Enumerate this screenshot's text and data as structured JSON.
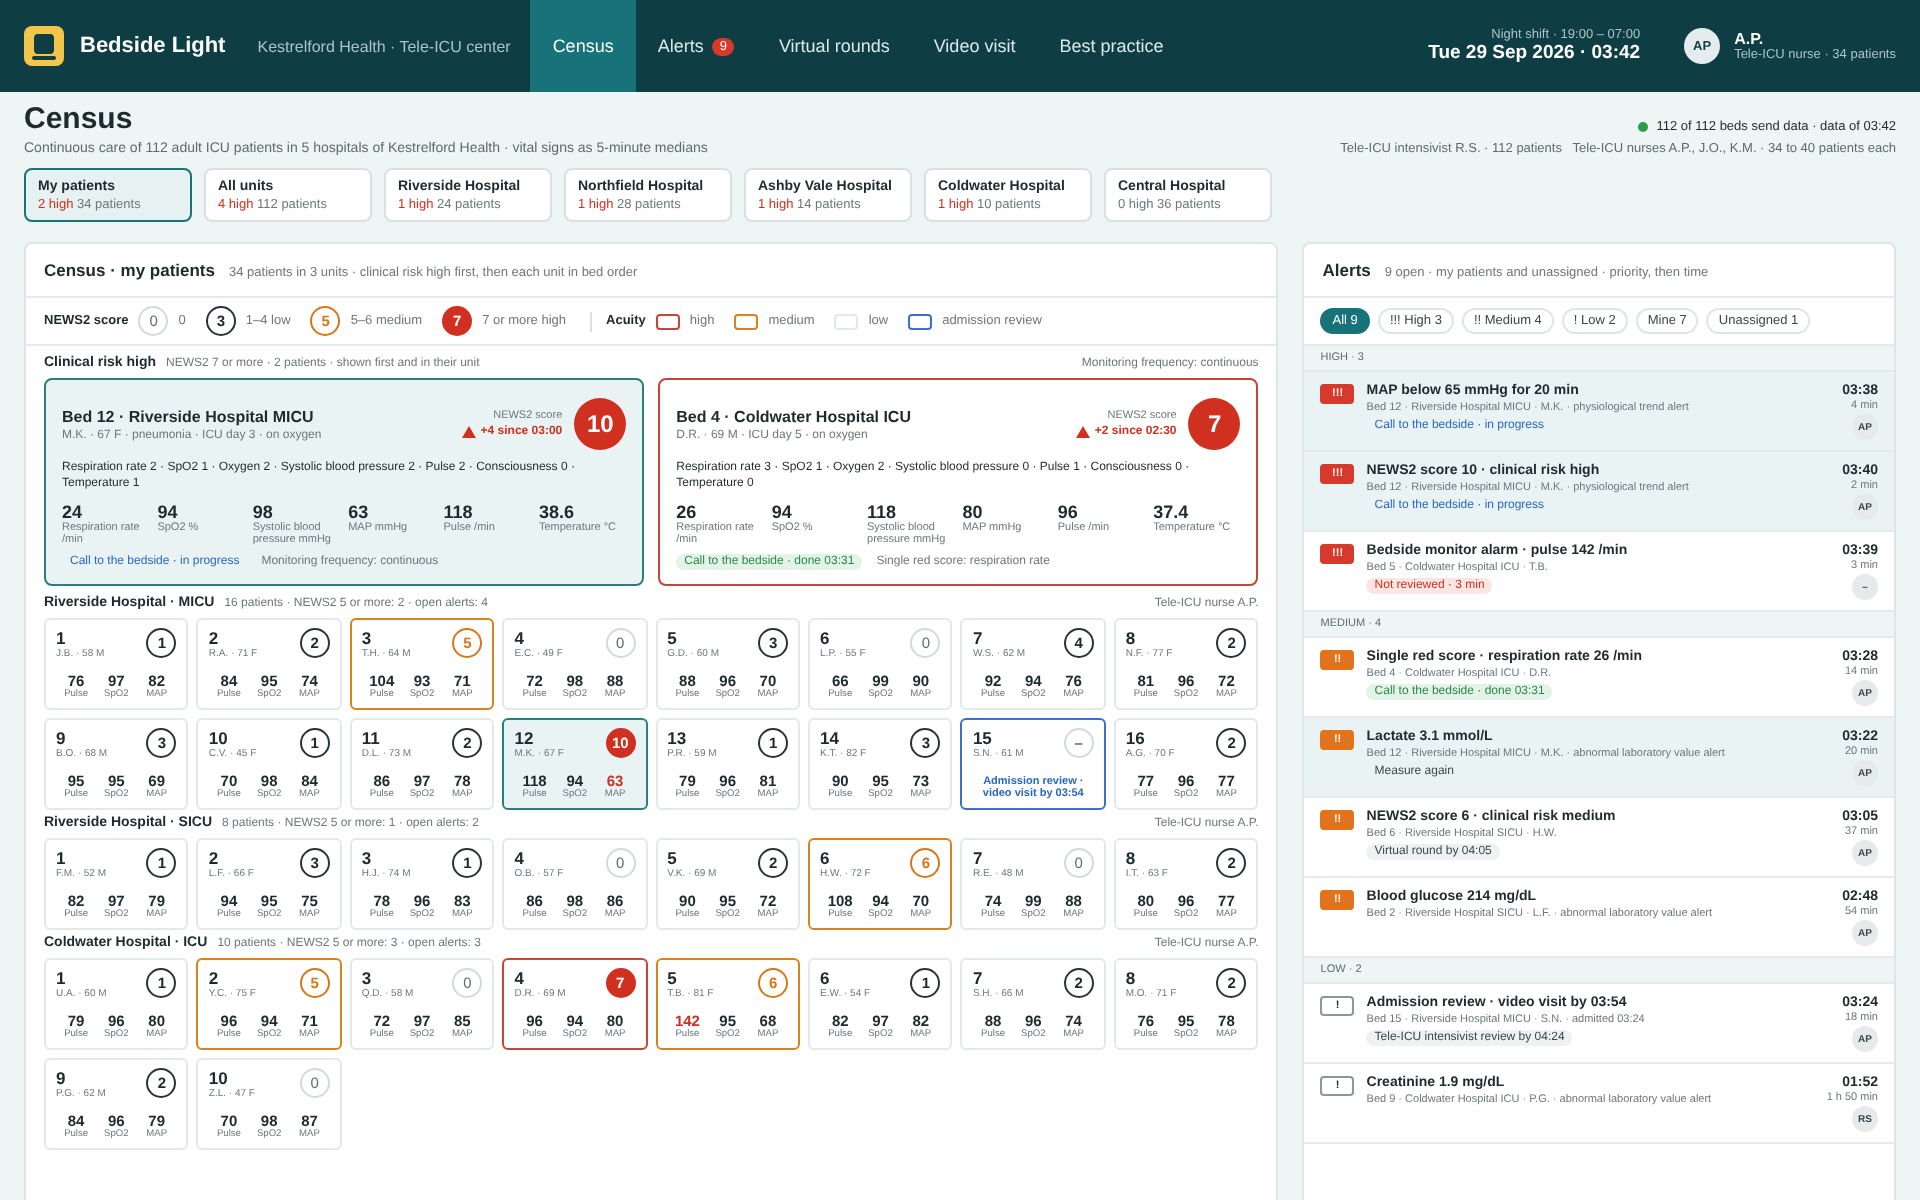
{
  "topbar": {
    "app_name": "Bedside Light",
    "org": "Kestrelford Health · Tele-ICU center",
    "shift": "Night shift · 19:00 – 07:00",
    "date": "Tue 29 Sep 2026 · 03:42",
    "avatar": "AP",
    "user": "A.P.",
    "role": "Tele-ICU nurse · 34 patients"
  },
  "nav": [
    {
      "label": "Census",
      "selected": true
    },
    {
      "label": "Alerts",
      "selected": false,
      "badge": "9"
    },
    {
      "label": "Virtual rounds",
      "selected": false
    },
    {
      "label": "Video visit",
      "selected": false
    },
    {
      "label": "Best practice",
      "selected": false
    }
  ],
  "header": {
    "title": "Census",
    "subtitle": "Continuous care of 112 adult ICU patients in 5 hospitals of Kestrelford Health · vital signs as 5-minute medians",
    "data_status": "112 of 112 beds send data · data of 03:42",
    "staff": "Tele-ICU intensivist R.S. · 112 patients   Tele-ICU nurses A.P., J.O., K.M. · 34 to 40 patients each"
  },
  "hospitals": [
    {
      "name": "My patients",
      "high": "2 high",
      "alert": true,
      "count": "34 patients",
      "selected": true
    },
    {
      "name": "All units",
      "high": "4 high",
      "alert": true,
      "count": "112 patients",
      "selected": false
    },
    {
      "name": "Riverside Hospital",
      "high": "1 high",
      "alert": true,
      "count": "24 patients",
      "selected": false
    },
    {
      "name": "Northfield Hospital",
      "high": "1 high",
      "alert": true,
      "count": "28 patients",
      "selected": false
    },
    {
      "name": "Ashby Vale Hospital",
      "high": "1 high",
      "alert": true,
      "count": "14 patients",
      "selected": false
    },
    {
      "name": "Coldwater Hospital",
      "high": "1 high",
      "alert": true,
      "count": "10 patients",
      "selected": false
    },
    {
      "name": "Central Hospital",
      "high": "0 high",
      "alert": false,
      "count": "36 patients",
      "selected": false
    }
  ],
  "census": {
    "title": "Census · my patients",
    "summary": "34 patients in 3 units · clinical risk high first, then each unit in bed order",
    "legend": {
      "score_title": "NEWS2 score",
      "scores": [
        {
          "score": {
            "value": "0",
            "kind": "zero"
          },
          "label": "0"
        },
        {
          "score": {
            "value": "3",
            "kind": "low"
          },
          "label": "1–4 low"
        },
        {
          "score": {
            "value": "5",
            "kind": "medium"
          },
          "label": "5–6 medium"
        },
        {
          "score": {
            "value": "7",
            "kind": "high"
          },
          "label": "7 or more high"
        }
      ],
      "acuity_title": "Acuity",
      "acuity": [
        {
          "label": "high",
          "kind": "high"
        },
        {
          "label": "medium",
          "kind": "medium"
        },
        {
          "label": "low",
          "kind": "low"
        },
        {
          "label": "admission review",
          "kind": "review"
        }
      ]
    },
    "risk": {
      "title": "Clinical risk high",
      "summary": "NEWS2 7 or more · 2 patients · shown first and in their unit",
      "frequency": "Monitoring frequency: continuous",
      "cards": [
        {
          "title": "Bed 12 · Riverside Hospital MICU",
          "patient": "M.K. · 67 F · pneumonia · ICU day 3 · on oxygen",
          "score_label": "NEWS2 score",
          "trend": "+4 since 03:00",
          "score": {
            "value": "10",
            "kind": "high"
          },
          "kind": "high",
          "selected": true,
          "breakdown": "Respiration rate 2 · SpO2 1 · Oxygen 2 · Systolic blood pressure 2 · Pulse 2 · Consciousness 0 · Temperature 1",
          "vitals": [
            {
              "value": "24",
              "label": "Respiration rate /min"
            },
            {
              "value": "94",
              "label": "SpO2 %"
            },
            {
              "value": "98",
              "label": "Systolic blood pressure mmHg"
            },
            {
              "value": "63",
              "label": "MAP mmHg"
            },
            {
              "value": "118",
              "label": "Pulse /min"
            },
            {
              "value": "38.6",
              "label": "Temperature °C"
            }
          ],
          "status": {
            "text": "Call to the bedside · in progress",
            "kind": "progress"
          },
          "note": "Monitoring frequency: continuous"
        },
        {
          "title": "Bed 4 · Coldwater Hospital ICU",
          "patient": "D.R. · 69 M · ICU day 5 · on oxygen",
          "score_label": "NEWS2 score",
          "trend": "+2 since 02:30",
          "score": {
            "value": "7",
            "kind": "high"
          },
          "kind": "high",
          "selected": false,
          "breakdown": "Respiration rate 3 · SpO2 1 · Oxygen 2 · Systolic blood pressure 0 · Pulse 1 · Consciousness 0 · Temperature 0",
          "vitals": [
            {
              "value": "26",
              "label": "Respiration rate /min"
            },
            {
              "value": "94",
              "label": "SpO2 %"
            },
            {
              "value": "118",
              "label": "Systolic blood pressure mmHg"
            },
            {
              "value": "80",
              "label": "MAP mmHg"
            },
            {
              "value": "96",
              "label": "Pulse /min"
            },
            {
              "value": "37.4",
              "label": "Temperature °C"
            }
          ],
          "status": {
            "text": "Call to the bedside · done 03:31",
            "kind": "done"
          },
          "note": "Single red score: respiration rate"
        }
      ]
    },
    "units": [
      {
        "name": "Riverside Hospital · MICU",
        "summary": "16 patients · NEWS2 5 or more: 2 · open alerts: 4",
        "nurse": "Tele-ICU nurse A.P.",
        "tiles": [
          {
            "bed": "1",
            "patient": "J.B. · 58 M",
            "score": {
              "value": "1",
              "kind": "low"
            },
            "kind": "low",
            "selected": false,
            "vitals": [
              {
                "value": "76",
                "label": "Pulse",
                "abnormal": false
              },
              {
                "value": "97",
                "label": "SpO2",
                "abnormal": false
              },
              {
                "value": "82",
                "label": "MAP",
                "abnormal": false
              }
            ]
          },
          {
            "bed": "2",
            "patient": "R.A. · 71 F",
            "score": {
              "value": "2",
              "kind": "low"
            },
            "kind": "low",
            "selected": false,
            "vitals": [
              {
                "value": "84",
                "label": "Pulse",
                "abnormal": false
              },
              {
                "value": "95",
                "label": "SpO2",
                "abnormal": false
              },
              {
                "value": "74",
                "label": "MAP",
                "abnormal": false
              }
            ]
          },
          {
            "bed": "3",
            "patient": "T.H. · 64 M",
            "score": {
              "value": "5",
              "kind": "medium"
            },
            "kind": "medium",
            "selected": false,
            "vitals": [
              {
                "value": "104",
                "label": "Pulse",
                "abnormal": false
              },
              {
                "value": "93",
                "label": "SpO2",
                "abnormal": false
              },
              {
                "value": "71",
                "label": "MAP",
                "abnormal": false
              }
            ]
          },
          {
            "bed": "4",
            "patient": "E.C. · 49 F",
            "score": {
              "value": "0",
              "kind": "zero"
            },
            "kind": "low",
            "selected": false,
            "vitals": [
              {
                "value": "72",
                "label": "Pulse",
                "abnormal": false
              },
              {
                "value": "98",
                "label": "SpO2",
                "abnormal": false
              },
              {
                "value": "88",
                "label": "MAP",
                "abnormal": false
              }
            ]
          },
          {
            "bed": "5",
            "patient": "G.D. · 60 M",
            "score": {
              "value": "3",
              "kind": "low"
            },
            "kind": "low",
            "selected": false,
            "vitals": [
              {
                "value": "88",
                "label": "Pulse",
                "abnormal": false
              },
              {
                "value": "96",
                "label": "SpO2",
                "abnormal": false
              },
              {
                "value": "70",
                "label": "MAP",
                "abnormal": false
              }
            ]
          },
          {
            "bed": "6",
            "patient": "L.P. · 55 F",
            "score": {
              "value": "0",
              "kind": "zero"
            },
            "kind": "low",
            "selected": false,
            "vitals": [
              {
                "value": "66",
                "label": "Pulse",
                "abnormal": false
              },
              {
                "value": "99",
                "label": "SpO2",
                "abnormal": false
              },
              {
                "value": "90",
                "label": "MAP",
                "abnormal": false
              }
            ]
          },
          {
            "bed": "7",
            "patient": "W.S. · 62 M",
            "score": {
              "value": "4",
              "kind": "low"
            },
            "kind": "low",
            "selected": false,
            "vitals": [
              {
                "value": "92",
                "label": "Pulse",
                "abnormal": false
              },
              {
                "value": "94",
                "label": "SpO2",
                "abnormal": false
              },
              {
                "value": "76",
                "label": "MAP",
                "abnormal": false
              }
            ]
          },
          {
            "bed": "8",
            "patient": "N.F. · 77 F",
            "score": {
              "value": "2",
              "kind": "low"
            },
            "kind": "low",
            "selected": false,
            "vitals": [
              {
                "value": "81",
                "label": "Pulse",
                "abnormal": false
              },
              {
                "value": "96",
                "label": "SpO2",
                "abnormal": false
              },
              {
                "value": "72",
                "label": "MAP",
                "abnormal": false
              }
            ]
          },
          {
            "bed": "9",
            "patient": "B.O. · 68 M",
            "score": {
              "value": "3",
              "kind": "low"
            },
            "kind": "low",
            "selected": false,
            "vitals": [
              {
                "value": "95",
                "label": "Pulse",
                "abnormal": false
              },
              {
                "value": "95",
                "label": "SpO2",
                "abnormal": false
              },
              {
                "value": "69",
                "label": "MAP",
                "abnormal": false
              }
            ]
          },
          {
            "bed": "10",
            "patient": "C.V. · 45 F",
            "score": {
              "value": "1",
              "kind": "low"
            },
            "kind": "low",
            "selected": false,
            "vitals": [
              {
                "value": "70",
                "label": "Pulse",
                "abnormal": false
              },
              {
                "value": "98",
                "label": "SpO2",
                "abnormal": false
              },
              {
                "value": "84",
                "label": "MAP",
                "abnormal": false
              }
            ]
          },
          {
            "bed": "11",
            "patient": "D.L. · 73 M",
            "score": {
              "value": "2",
              "kind": "low"
            },
            "kind": "low",
            "selected": false,
            "vitals": [
              {
                "value": "86",
                "label": "Pulse",
                "abnormal": false
              },
              {
                "value": "97",
                "label": "SpO2",
                "abnormal": false
              },
              {
                "value": "78",
                "label": "MAP",
                "abnormal": false
              }
            ]
          },
          {
            "bed": "12",
            "patient": "M.K. · 67 F",
            "score": {
              "value": "10",
              "kind": "high"
            },
            "kind": "high",
            "selected": true,
            "vitals": [
              {
                "value": "118",
                "label": "Pulse",
                "abnormal": false
              },
              {
                "value": "94",
                "label": "SpO2",
                "abnormal": false
              },
              {
                "value": "63",
                "label": "MAP",
                "abnormal": true
              }
            ]
          },
          {
            "bed": "13",
            "patient": "P.R. · 59 M",
            "score": {
              "value": "1",
              "kind": "low"
            },
            "kind": "low",
            "selected": false,
            "vitals": [
              {
                "value": "79",
                "label": "Pulse",
                "abnormal": false
              },
              {
                "value": "96",
                "label": "SpO2",
                "abnormal": false
              },
              {
                "value": "81",
                "label": "MAP",
                "abnormal": false
              }
            ]
          },
          {
            "bed": "14",
            "patient": "K.T. · 82 F",
            "score": {
              "value": "3",
              "kind": "low"
            },
            "kind": "low",
            "selected": false,
            "vitals": [
              {
                "value": "90",
                "label": "Pulse",
                "abnormal": false
              },
              {
                "value": "95",
                "label": "SpO2",
                "abnormal": false
              },
              {
                "value": "73",
                "label": "MAP",
                "abnormal": false
              }
            ]
          },
          {
            "bed": "15",
            "patient": "S.N. · 61 M",
            "score": {
              "value": "–",
              "kind": "none"
            },
            "kind": "review",
            "selected": false,
            "note": "Admission review · video visit by 03:54"
          },
          {
            "bed": "16",
            "patient": "A.G. · 70 F",
            "score": {
              "value": "2",
              "kind": "low"
            },
            "kind": "low",
            "selected": false,
            "vitals": [
              {
                "value": "77",
                "label": "Pulse",
                "abnormal": false
              },
              {
                "value": "96",
                "label": "SpO2",
                "abnormal": false
              },
              {
                "value": "77",
                "label": "MAP",
                "abnormal": false
              }
            ]
          }
        ]
      },
      {
        "name": "Riverside Hospital · SICU",
        "summary": "8 patients · NEWS2 5 or more: 1 · open alerts: 2",
        "nurse": "Tele-ICU nurse A.P.",
        "tiles": [
          {
            "bed": "1",
            "patient": "F.M. · 52 M",
            "score": {
              "value": "1",
              "kind": "low"
            },
            "kind": "low",
            "selected": false,
            "vitals": [
              {
                "value": "82",
                "label": "Pulse",
                "abnormal": false
              },
              {
                "value": "97",
                "label": "SpO2",
                "abnormal": false
              },
              {
                "value": "79",
                "label": "MAP",
                "abnormal": false
              }
            ]
          },
          {
            "bed": "2",
            "patient": "L.F. · 66 F",
            "score": {
              "value": "3",
              "kind": "low"
            },
            "kind": "low",
            "selected": false,
            "vitals": [
              {
                "value": "94",
                "label": "Pulse",
                "abnormal": false
              },
              {
                "value": "95",
                "label": "SpO2",
                "abnormal": false
              },
              {
                "value": "75",
                "label": "MAP",
                "abnormal": false
              }
            ]
          },
          {
            "bed": "3",
            "patient": "H.J. · 74 M",
            "score": {
              "value": "1",
              "kind": "low"
            },
            "kind": "low",
            "selected": false,
            "vitals": [
              {
                "value": "78",
                "label": "Pulse",
                "abnormal": false
              },
              {
                "value": "96",
                "label": "SpO2",
                "abnormal": false
              },
              {
                "value": "83",
                "label": "MAP",
                "abnormal": false
              }
            ]
          },
          {
            "bed": "4",
            "patient": "O.B. · 57 F",
            "score": {
              "value": "0",
              "kind": "zero"
            },
            "kind": "low",
            "selected": false,
            "vitals": [
              {
                "value": "86",
                "label": "Pulse",
                "abnormal": false
              },
              {
                "value": "98",
                "label": "SpO2",
                "abnormal": false
              },
              {
                "value": "86",
                "label": "MAP",
                "abnormal": false
              }
            ]
          },
          {
            "bed": "5",
            "patient": "V.K. · 69 M",
            "score": {
              "value": "2",
              "kind": "low"
            },
            "kind": "low",
            "selected": false,
            "vitals": [
              {
                "value": "90",
                "label": "Pulse",
                "abnormal": false
              },
              {
                "value": "95",
                "label": "SpO2",
                "abnormal": false
              },
              {
                "value": "72",
                "label": "MAP",
                "abnormal": false
              }
            ]
          },
          {
            "bed": "6",
            "patient": "H.W. · 72 F",
            "score": {
              "value": "6",
              "kind": "medium"
            },
            "kind": "medium",
            "selected": false,
            "vitals": [
              {
                "value": "108",
                "label": "Pulse",
                "abnormal": false
              },
              {
                "value": "94",
                "label": "SpO2",
                "abnormal": false
              },
              {
                "value": "70",
                "label": "MAP",
                "abnormal": false
              }
            ]
          },
          {
            "bed": "7",
            "patient": "R.E. · 48 M",
            "score": {
              "value": "0",
              "kind": "zero"
            },
            "kind": "low",
            "selected": false,
            "vitals": [
              {
                "value": "74",
                "label": "Pulse",
                "abnormal": false
              },
              {
                "value": "99",
                "label": "SpO2",
                "abnormal": false
              },
              {
                "value": "88",
                "label": "MAP",
                "abnormal": false
              }
            ]
          },
          {
            "bed": "8",
            "patient": "I.T. · 63 F",
            "score": {
              "value": "2",
              "kind": "low"
            },
            "kind": "low",
            "selected": false,
            "vitals": [
              {
                "value": "80",
                "label": "Pulse",
                "abnormal": false
              },
              {
                "value": "96",
                "label": "SpO2",
                "abnormal": false
              },
              {
                "value": "77",
                "label": "MAP",
                "abnormal": false
              }
            ]
          }
        ]
      },
      {
        "name": "Coldwater Hospital · ICU",
        "summary": "10 patients · NEWS2 5 or more: 3 · open alerts: 3",
        "nurse": "Tele-ICU nurse A.P.",
        "tiles": [
          {
            "bed": "1",
            "patient": "U.A. · 60 M",
            "score": {
              "value": "1",
              "kind": "low"
            },
            "kind": "low",
            "selected": false,
            "vitals": [
              {
                "value": "79",
                "label": "Pulse",
                "abnormal": false
              },
              {
                "value": "96",
                "label": "SpO2",
                "abnormal": false
              },
              {
                "value": "80",
                "label": "MAP",
                "abnormal": false
              }
            ]
          },
          {
            "bed": "2",
            "patient": "Y.C. · 75 F",
            "score": {
              "value": "5",
              "kind": "medium"
            },
            "kind": "medium",
            "selected": false,
            "vitals": [
              {
                "value": "96",
                "label": "Pulse",
                "abnormal": false
              },
              {
                "value": "94",
                "label": "SpO2",
                "abnormal": false
              },
              {
                "value": "71",
                "label": "MAP",
                "abnormal": false
              }
            ]
          },
          {
            "bed": "3",
            "patient": "Q.D. · 58 M",
            "score": {
              "value": "0",
              "kind": "zero"
            },
            "kind": "low",
            "selected": false,
            "vitals": [
              {
                "value": "72",
                "label": "Pulse",
                "abnormal": false
              },
              {
                "value": "97",
                "label": "SpO2",
                "abnormal": false
              },
              {
                "value": "85",
                "label": "MAP",
                "abnormal": false
              }
            ]
          },
          {
            "bed": "4",
            "patient": "D.R. · 69 M",
            "score": {
              "value": "7",
              "kind": "high"
            },
            "kind": "high",
            "selected": false,
            "vitals": [
              {
                "value": "96",
                "label": "Pulse",
                "abnormal": false
              },
              {
                "value": "94",
                "label": "SpO2",
                "abnormal": false
              },
              {
                "value": "80",
                "label": "MAP",
                "abnormal": false
              }
            ]
          },
          {
            "bed": "5",
            "patient": "T.B. · 81 F",
            "score": {
              "value": "6",
              "kind": "medium"
            },
            "kind": "medium",
            "selected": false,
            "vitals": [
              {
                "value": "142",
                "label": "Pulse",
                "abnormal": true
              },
              {
                "value": "95",
                "label": "SpO2",
                "abnormal": false
              },
              {
                "value": "68",
                "label": "MAP",
                "abnormal": false
              }
            ]
          },
          {
            "bed": "6",
            "patient": "E.W. · 54 F",
            "score": {
              "value": "1",
              "kind": "low"
            },
            "kind": "low",
            "selected": false,
            "vitals": [
              {
                "value": "82",
                "label": "Pulse",
                "abnormal": false
              },
              {
                "value": "97",
                "label": "SpO2",
                "abnormal": false
              },
              {
                "value": "82",
                "label": "MAP",
                "abnormal": false
              }
            ]
          },
          {
            "bed": "7",
            "patient": "S.H. · 66 M",
            "score": {
              "value": "2",
              "kind": "low"
            },
            "kind": "low",
            "selected": false,
            "vitals": [
              {
                "value": "88",
                "label": "Pulse",
                "abnormal": false
              },
              {
                "value": "96",
                "label": "SpO2",
                "abnormal": false
              },
              {
                "value": "74",
                "label": "MAP",
                "abnormal": false
              }
            ]
          },
          {
            "bed": "8",
            "patient": "M.O. · 71 F",
            "score": {
              "value": "2",
              "kind": "low"
            },
            "kind": "low",
            "selected": false,
            "vitals": [
              {
                "value": "76",
                "label": "Pulse",
                "abnormal": false
              },
              {
                "value": "95",
                "label": "SpO2",
                "abnormal": false
              },
              {
                "value": "78",
                "label": "MAP",
                "abnormal": false
              }
            ]
          },
          {
            "bed": "9",
            "patient": "P.G. · 62 M",
            "score": {
              "value": "2",
              "kind": "low"
            },
            "kind": "low",
            "selected": false,
            "vitals": [
              {
                "value": "84",
                "label": "Pulse",
                "abnormal": false
              },
              {
                "value": "96",
                "label": "SpO2",
                "abnormal": false
              },
              {
                "value": "79",
                "label": "MAP",
                "abnormal": false
              }
            ]
          },
          {
            "bed": "10",
            "patient": "Z.L. · 47 F",
            "score": {
              "value": "0",
              "kind": "zero"
            },
            "kind": "low",
            "selected": false,
            "vitals": [
              {
                "value": "70",
                "label": "Pulse",
                "abnormal": false
              },
              {
                "value": "98",
                "label": "SpO2",
                "abnormal": false
              },
              {
                "value": "87",
                "label": "MAP",
                "abnormal": false
              }
            ]
          }
        ]
      }
    ]
  },
  "alerts": {
    "title": "Alerts",
    "summary": "9 open · my patients and unassigned · priority, then time",
    "filters": [
      {
        "label": "All 9",
        "selected": true
      },
      {
        "label": "!!! High 3",
        "selected": false
      },
      {
        "label": "!! Medium 4",
        "selected": false
      },
      {
        "label": "! Low 2",
        "selected": false
      },
      {
        "label": "Mine 7",
        "selected": false
      },
      {
        "label": "Unassigned 1",
        "selected": false
      }
    ],
    "groups": [
      {
        "title": "HIGH · 3",
        "items": [
          {
            "kind": "high",
            "mark": "!!!",
            "title": "MAP below 65 mmHg for 20 min",
            "detail": "Bed 12 · Riverside Hospital MICU · M.K. · physiological trend alert",
            "status": {
              "text": "Call to the bedside · in progress",
              "kind": "progress"
            },
            "time": "03:38",
            "ago": "4 min",
            "assignee": "AP",
            "selected": true
          },
          {
            "kind": "high",
            "mark": "!!!",
            "title": "NEWS2 score 10 · clinical risk high",
            "detail": "Bed 12 · Riverside Hospital MICU · M.K. · physiological trend alert",
            "status": {
              "text": "Call to the bedside · in progress",
              "kind": "progress"
            },
            "time": "03:40",
            "ago": "2 min",
            "assignee": "AP",
            "selected": true
          },
          {
            "kind": "high",
            "mark": "!!!",
            "title": "Bedside monitor alarm · pulse 142 /min",
            "detail": "Bed 5 · Coldwater Hospital ICU · T.B.",
            "status": {
              "text": "Not reviewed · 3 min",
              "kind": "alarm"
            },
            "time": "03:39",
            "ago": "3 min",
            "assignee": "–",
            "selected": false
          }
        ]
      },
      {
        "title": "MEDIUM · 4",
        "items": [
          {
            "kind": "medium",
            "mark": "!!",
            "title": "Single red score · respiration rate 26 /min",
            "detail": "Bed 4 · Coldwater Hospital ICU · D.R.",
            "status": {
              "text": "Call to the bedside · done 03:31",
              "kind": "done"
            },
            "time": "03:28",
            "ago": "14 min",
            "assignee": "AP",
            "selected": false
          },
          {
            "kind": "medium",
            "mark": "!!",
            "title": "Lactate 3.1 mmol/L",
            "detail": "Bed 12 · Riverside Hospital MICU · M.K. · abnormal laboratory value alert",
            "status": {
              "text": "Measure again",
              "kind": "plain"
            },
            "time": "03:22",
            "ago": "20 min",
            "assignee": "AP",
            "selected": true
          },
          {
            "kind": "medium",
            "mark": "!!",
            "title": "NEWS2 score 6 · clinical risk medium",
            "detail": "Bed 6 · Riverside Hospital SICU · H.W.",
            "status": {
              "text": "Virtual round by 04:05",
              "kind": "neutral"
            },
            "time": "03:05",
            "ago": "37 min",
            "assignee": "AP",
            "selected": false
          },
          {
            "kind": "medium",
            "mark": "!!",
            "title": "Blood glucose 214 mg/dL",
            "detail": "Bed 2 · Riverside Hospital SICU · L.F. · abnormal laboratory value alert",
            "time": "02:48",
            "ago": "54 min",
            "assignee": "AP",
            "selected": false
          }
        ]
      },
      {
        "title": "LOW · 2",
        "items": [
          {
            "kind": "low",
            "mark": "!",
            "title": "Admission review · video visit by 03:54",
            "detail": "Bed 15 · Riverside Hospital MICU · S.N. · admitted 03:24",
            "status": {
              "text": "Tele-ICU intensivist review by 04:24",
              "kind": "neutral"
            },
            "time": "03:24",
            "ago": "18 min",
            "assignee": "AP",
            "selected": false
          },
          {
            "kind": "low",
            "mark": "!",
            "title": "Creatinine 1.9 mg/dL",
            "detail": "Bed 9 · Coldwater Hospital ICU · P.G. · abnormal laboratory value alert",
            "time": "01:52",
            "ago": "1 h 50 min",
            "assignee": "RS",
            "selected": false
          }
        ]
      }
    ]
  }
}
